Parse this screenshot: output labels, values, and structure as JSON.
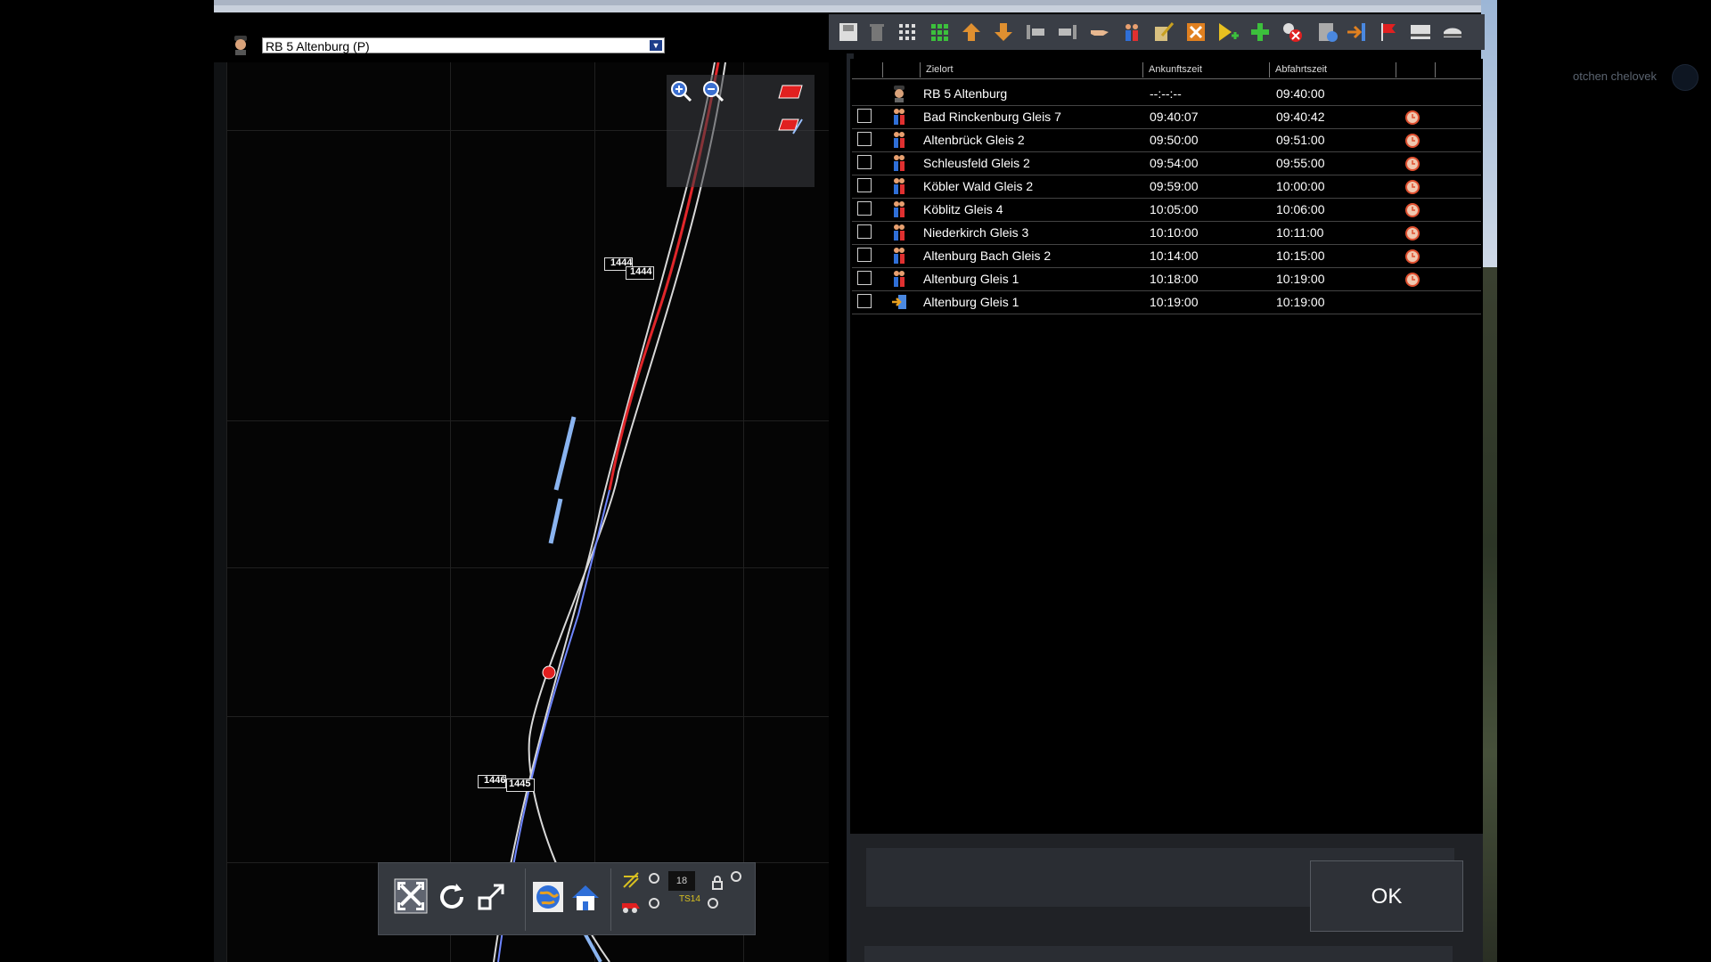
{
  "window": {
    "user_name": "otchen chelovek"
  },
  "map": {
    "train_selector_value": "RB 5 Altenburg (P)",
    "signal_labels": [
      "1444",
      "1444",
      "1446",
      "1445"
    ],
    "stepper_value": "18",
    "mini_label": "TS14"
  },
  "toolbar": {
    "icons": [
      "save-icon",
      "trash-icon",
      "grid-white-icon",
      "grid-green-icon",
      "arrow-up-icon",
      "arrow-down-icon",
      "align-left-icon",
      "align-right-icon",
      "hand-point-icon",
      "passengers-icon",
      "edit-icon",
      "expand-icon",
      "add-yellow-icon",
      "add-green-icon",
      "delete-red-icon",
      "settings-icon",
      "exit-arrow-icon",
      "red-flag-icon",
      "window-icon",
      "train-roof-icon"
    ]
  },
  "timetable": {
    "columns": [
      "Zielort",
      "Ankunftszeit",
      "Abfahrtszeit"
    ],
    "rows": [
      {
        "type": "driver",
        "dest": "RB 5 Altenburg",
        "arr": "--:--:--",
        "dep": "09:40:00",
        "checkbox": false,
        "clock": false
      },
      {
        "type": "stop",
        "dest": "Bad Rinckenburg Gleis 7",
        "arr": "09:40:07",
        "dep": "09:40:42",
        "checkbox": true,
        "clock": true
      },
      {
        "type": "stop",
        "dest": "Altenbrück Gleis 2",
        "arr": "09:50:00",
        "dep": "09:51:00",
        "checkbox": true,
        "clock": true
      },
      {
        "type": "stop",
        "dest": "Schleusfeld Gleis 2",
        "arr": "09:54:00",
        "dep": "09:55:00",
        "checkbox": true,
        "clock": true
      },
      {
        "type": "stop",
        "dest": "Köbler Wald Gleis 2",
        "arr": "09:59:00",
        "dep": "10:00:00",
        "checkbox": true,
        "clock": true
      },
      {
        "type": "stop",
        "dest": "Köblitz Gleis 4",
        "arr": "10:05:00",
        "dep": "10:06:00",
        "checkbox": true,
        "clock": true
      },
      {
        "type": "stop",
        "dest": "Niederkirch Gleis 3",
        "arr": "10:10:00",
        "dep": "10:11:00",
        "checkbox": true,
        "clock": true
      },
      {
        "type": "stop",
        "dest": "Altenburg Bach Gleis 2",
        "arr": "10:14:00",
        "dep": "10:15:00",
        "checkbox": true,
        "clock": true
      },
      {
        "type": "stop",
        "dest": "Altenburg Gleis 1",
        "arr": "10:18:00",
        "dep": "10:19:00",
        "checkbox": true,
        "clock": true
      },
      {
        "type": "end",
        "dest": "Altenburg Gleis 1",
        "arr": "10:19:00",
        "dep": "10:19:00",
        "checkbox": true,
        "clock": false
      }
    ]
  },
  "dialog": {
    "ok_label": "OK"
  },
  "colors": {
    "route_red": "#e0262a",
    "route_blue": "#6f86ff",
    "track_white": "#d8d8d8",
    "highlight_blue": "#8ab4f0"
  }
}
